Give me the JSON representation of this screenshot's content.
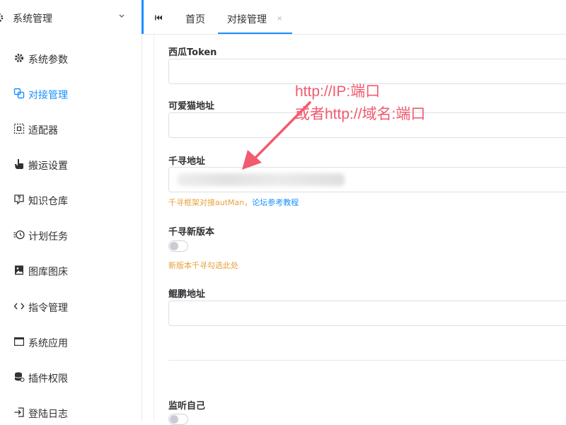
{
  "sidebar": {
    "header": {
      "title": "系统管理",
      "icon": "gear-icon"
    },
    "items": [
      {
        "label": "系统参数",
        "icon": "gear-icon",
        "active": false
      },
      {
        "label": "对接管理",
        "icon": "link-icon",
        "active": true
      },
      {
        "label": "适配器",
        "icon": "adapter-icon",
        "active": false
      },
      {
        "label": "搬运设置",
        "icon": "hand-icon",
        "active": false
      },
      {
        "label": "知识仓库",
        "icon": "question-icon",
        "active": false
      },
      {
        "label": "计划任务",
        "icon": "clock-icon",
        "active": false
      },
      {
        "label": "图库图床",
        "icon": "image-icon",
        "active": false
      },
      {
        "label": "指令管理",
        "icon": "code-icon",
        "active": false
      },
      {
        "label": "系统应用",
        "icon": "window-icon",
        "active": false
      },
      {
        "label": "插件权限",
        "icon": "database-icon",
        "active": false
      },
      {
        "label": "登陆日志",
        "icon": "login-icon",
        "active": false
      }
    ]
  },
  "tabs": {
    "home": "首页",
    "active": "对接管理",
    "close": "×"
  },
  "form": {
    "xigua_label": "西瓜Token",
    "xigua_value": "",
    "keai_label": "可爱猫地址",
    "keai_value": "",
    "qianxun_label": "千寻地址",
    "qianxun_hint_prefix": "千寻框架对接autMan，",
    "qianxun_hint_link": "论坛参考教程",
    "qianxun_new_label": "千寻新版本",
    "qianxun_new_on": false,
    "qianxun_new_hint": "新版本千寻勾选此处",
    "kunpeng_label": "鲲鹏地址",
    "kunpeng_value": "",
    "listen_self_label": "监听自己",
    "listen_self_on": false
  },
  "annotation": {
    "line1": "http://IP:端口",
    "line2": "或者http://域名:端口",
    "color": "#f25a6e"
  },
  "colors": {
    "accent": "#1890ff",
    "hint": "#e6a23c"
  }
}
